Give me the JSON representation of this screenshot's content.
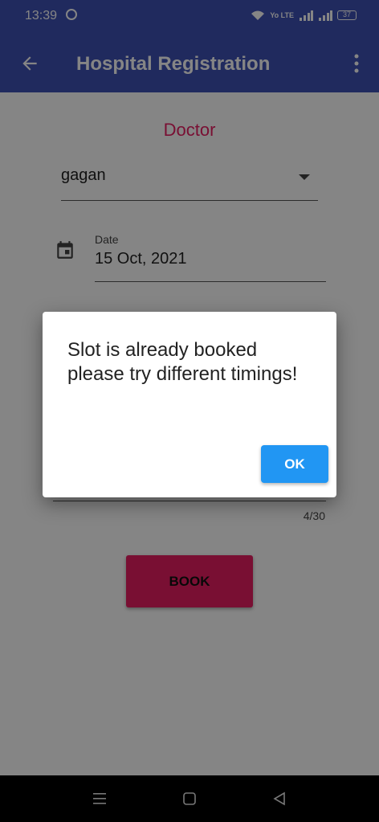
{
  "status_bar": {
    "time": "13:39",
    "data_label": "Yo LTE",
    "battery": "37"
  },
  "app_bar": {
    "title": "Hospital Registration",
    "back_icon": "arrow-left-icon",
    "menu_icon": "more-vert-icon"
  },
  "form": {
    "section_title": "Doctor",
    "doctor_value": "gagan",
    "date_label": "Date",
    "date_value": "15 Oct, 2021",
    "name_counter": "4/30",
    "book_label": "BOOK"
  },
  "dialog": {
    "message": "Slot is already booked please try different timings!",
    "ok_label": "OK"
  },
  "colors": {
    "primary": "#3f51b5",
    "accent": "#e91e63",
    "dialog_button": "#2196f3"
  }
}
